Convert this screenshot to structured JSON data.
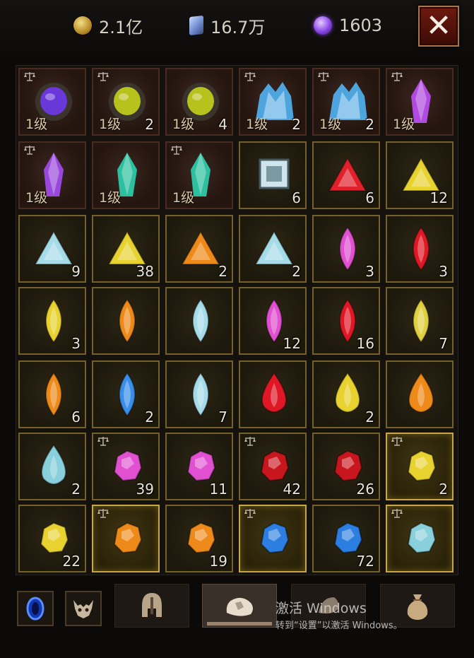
{
  "currencies": [
    {
      "icon": "gold-coin-icon",
      "value": "2.1亿"
    },
    {
      "icon": "crystal-shard-icon",
      "value": "16.7万"
    },
    {
      "icon": "purple-orb-icon",
      "value": "1603"
    }
  ],
  "close_label": "✕",
  "level_label": "1级",
  "slots": [
    {
      "icon": "purple-rune-stone-icon",
      "shape": "stone",
      "color": "#6a38d8",
      "count": "",
      "level": true,
      "tradable": true,
      "bg": "red"
    },
    {
      "icon": "yellow-rune-stone-icon",
      "shape": "stone",
      "color": "#b8c21c",
      "count": "2",
      "level": true,
      "tradable": true,
      "bg": "red"
    },
    {
      "icon": "yellow-rune-stone-icon",
      "shape": "stone",
      "color": "#b8c21c",
      "count": "4",
      "level": true,
      "tradable": false,
      "bg": "red"
    },
    {
      "icon": "blue-crystal-cluster-icon",
      "shape": "cluster",
      "color": "#4ea4dc",
      "count": "2",
      "level": true,
      "tradable": true,
      "bg": "red"
    },
    {
      "icon": "blue-crystal-cluster-icon",
      "shape": "cluster",
      "color": "#4ea4dc",
      "count": "2",
      "level": true,
      "tradable": true,
      "bg": "red"
    },
    {
      "icon": "purple-crystal-icon",
      "shape": "crystal",
      "color": "#b04ae0",
      "count": "",
      "level": true,
      "tradable": true,
      "bg": "red"
    },
    {
      "icon": "purple-crystal-shard-icon",
      "shape": "crystal",
      "color": "#9a48dc",
      "count": "",
      "level": true,
      "tradable": true,
      "bg": "red"
    },
    {
      "icon": "teal-crystal-shard-icon",
      "shape": "crystal",
      "color": "#2cc0a0",
      "count": "",
      "level": true,
      "tradable": false,
      "bg": "red"
    },
    {
      "icon": "teal-crystal-shard-icon",
      "shape": "crystal",
      "color": "#2cc0a0",
      "count": "",
      "level": true,
      "tradable": true,
      "bg": "red"
    },
    {
      "icon": "white-square-gem-icon",
      "shape": "square",
      "color": "#cfe4ec",
      "count": "6",
      "level": false,
      "tradable": false,
      "bg": "gold"
    },
    {
      "icon": "red-triangle-gem-icon",
      "shape": "triangle",
      "color": "#e0202a",
      "count": "6",
      "level": false,
      "tradable": false,
      "bg": "gold"
    },
    {
      "icon": "yellow-triangle-gem-icon",
      "shape": "triangle",
      "color": "#e8d230",
      "count": "12",
      "level": false,
      "tradable": false,
      "bg": "gold"
    },
    {
      "icon": "white-triangle-gem-icon",
      "shape": "triangle",
      "color": "#a6dce8",
      "count": "9",
      "level": false,
      "tradable": false,
      "bg": "gold"
    },
    {
      "icon": "yellow-triangle-gem-icon",
      "shape": "triangle",
      "color": "#e8d230",
      "count": "38",
      "level": false,
      "tradable": false,
      "bg": "gold"
    },
    {
      "icon": "orange-triangle-gem-icon",
      "shape": "triangle",
      "color": "#ee8a1a",
      "count": "2",
      "level": false,
      "tradable": false,
      "bg": "gold"
    },
    {
      "icon": "white-triangle-gem-icon",
      "shape": "triangle",
      "color": "#a6dce8",
      "count": "2",
      "level": false,
      "tradable": false,
      "bg": "gold"
    },
    {
      "icon": "pink-marquise-gem-icon",
      "shape": "marquise",
      "color": "#e050d0",
      "count": "3",
      "level": false,
      "tradable": false,
      "bg": "gold"
    },
    {
      "icon": "red-marquise-gem-icon",
      "shape": "marquise",
      "color": "#e01826",
      "count": "3",
      "level": false,
      "tradable": false,
      "bg": "gold"
    },
    {
      "icon": "yellow-marquise-gem-icon",
      "shape": "marquise",
      "color": "#e8d230",
      "count": "3",
      "level": false,
      "tradable": false,
      "bg": "gold"
    },
    {
      "icon": "orange-marquise-gem-icon",
      "shape": "marquise",
      "color": "#ee8a1a",
      "count": "",
      "level": false,
      "tradable": false,
      "bg": "gold"
    },
    {
      "icon": "white-marquise-gem-icon",
      "shape": "marquise",
      "color": "#a6dce8",
      "count": "",
      "level": false,
      "tradable": false,
      "bg": "gold"
    },
    {
      "icon": "pink-marquise-gem-icon",
      "shape": "marquise",
      "color": "#e050d0",
      "count": "12",
      "level": false,
      "tradable": false,
      "bg": "gold"
    },
    {
      "icon": "red-marquise-gem-icon",
      "shape": "marquise",
      "color": "#e01826",
      "count": "16",
      "level": false,
      "tradable": false,
      "bg": "gold"
    },
    {
      "icon": "yellow-marquise-gem-icon",
      "shape": "marquise",
      "color": "#e0d040",
      "count": "7",
      "level": false,
      "tradable": false,
      "bg": "gold"
    },
    {
      "icon": "orange-marquise-gem-icon",
      "shape": "marquise",
      "color": "#ee8a1a",
      "count": "6",
      "level": false,
      "tradable": false,
      "bg": "gold"
    },
    {
      "icon": "blue-marquise-gem-icon",
      "shape": "marquise",
      "color": "#3a8ee8",
      "count": "2",
      "level": false,
      "tradable": false,
      "bg": "gold"
    },
    {
      "icon": "white-marquise-gem-icon",
      "shape": "marquise",
      "color": "#a6dce8",
      "count": "7",
      "level": false,
      "tradable": false,
      "bg": "gold"
    },
    {
      "icon": "red-teardrop-gem-icon",
      "shape": "teardrop",
      "color": "#e01826",
      "count": "",
      "level": false,
      "tradable": false,
      "bg": "gold"
    },
    {
      "icon": "yellow-teardrop-gem-icon",
      "shape": "teardrop",
      "color": "#e8d230",
      "count": "2",
      "level": false,
      "tradable": false,
      "bg": "gold"
    },
    {
      "icon": "orange-teardrop-gem-icon",
      "shape": "teardrop",
      "color": "#ee8a1a",
      "count": "",
      "level": false,
      "tradable": false,
      "bg": "gold"
    },
    {
      "icon": "white-teardrop-gem-icon",
      "shape": "teardrop",
      "color": "#8ad0dc",
      "count": "2",
      "level": false,
      "tradable": false,
      "bg": "gold"
    },
    {
      "icon": "pink-rough-gem-icon",
      "shape": "rough",
      "color": "#e050d0",
      "count": "39",
      "level": false,
      "tradable": true,
      "bg": "gold"
    },
    {
      "icon": "pink-rough-gem-icon",
      "shape": "rough",
      "color": "#e050d0",
      "count": "11",
      "level": false,
      "tradable": false,
      "bg": "gold"
    },
    {
      "icon": "red-rough-gem-icon",
      "shape": "rough",
      "color": "#c8161e",
      "count": "42",
      "level": false,
      "tradable": true,
      "bg": "gold"
    },
    {
      "icon": "red-rough-gem-icon",
      "shape": "rough",
      "color": "#c8161e",
      "count": "26",
      "level": false,
      "tradable": false,
      "bg": "gold"
    },
    {
      "icon": "yellow-rough-gem-icon",
      "shape": "rough",
      "color": "#e8d230",
      "count": "2",
      "level": false,
      "tradable": true,
      "bg": "hl"
    },
    {
      "icon": "yellow-rough-gem-icon",
      "shape": "rough",
      "color": "#e8d230",
      "count": "22",
      "level": false,
      "tradable": false,
      "bg": "gold"
    },
    {
      "icon": "orange-rough-gem-icon",
      "shape": "rough",
      "color": "#ee8a1a",
      "count": "",
      "level": false,
      "tradable": true,
      "bg": "hl"
    },
    {
      "icon": "orange-rough-gem-icon",
      "shape": "rough",
      "color": "#ee8a1a",
      "count": "19",
      "level": false,
      "tradable": false,
      "bg": "gold"
    },
    {
      "icon": "blue-rough-gem-icon",
      "shape": "rough",
      "color": "#2c7ee0",
      "count": "",
      "level": false,
      "tradable": true,
      "bg": "hl"
    },
    {
      "icon": "blue-rough-gem-icon",
      "shape": "rough",
      "color": "#2c7ee0",
      "count": "72",
      "level": false,
      "tradable": false,
      "bg": "gold"
    },
    {
      "icon": "white-rough-gem-icon",
      "shape": "rough",
      "color": "#8ad0dc",
      "count": "",
      "level": false,
      "tradable": true,
      "bg": "hl"
    }
  ],
  "bottom_buttons": [
    {
      "icon": "blue-portal-icon"
    },
    {
      "icon": "demon-skull-icon"
    }
  ],
  "tabs": [
    {
      "icon": "helmet-icon",
      "active": false
    },
    {
      "icon": "gem-pouch-icon",
      "active": true
    },
    {
      "icon": "rune-icon",
      "active": false
    },
    {
      "icon": "loot-bag-icon",
      "active": false
    }
  ],
  "watermark": {
    "line1": "激活 Windows",
    "line2": "转到“设置”以激活 Windows。"
  }
}
